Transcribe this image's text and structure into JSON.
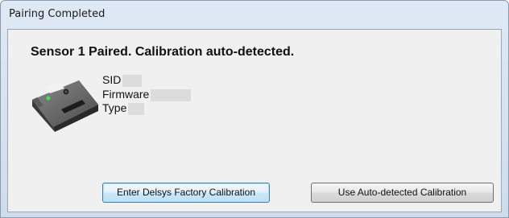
{
  "window": {
    "title": "Pairing Completed"
  },
  "dialog": {
    "headline": "Sensor 1 Paired. Calibration auto-detected.",
    "sensor_image_icon": "sensor-device-icon",
    "info": [
      {
        "label": "SID",
        "value": ""
      },
      {
        "label": "Firmware",
        "value": ""
      },
      {
        "label": "Type",
        "value": ""
      }
    ],
    "buttons": {
      "factory_label": "Enter Delsys Factory Calibration",
      "auto_label": "Use Auto-detected Calibration"
    }
  }
}
